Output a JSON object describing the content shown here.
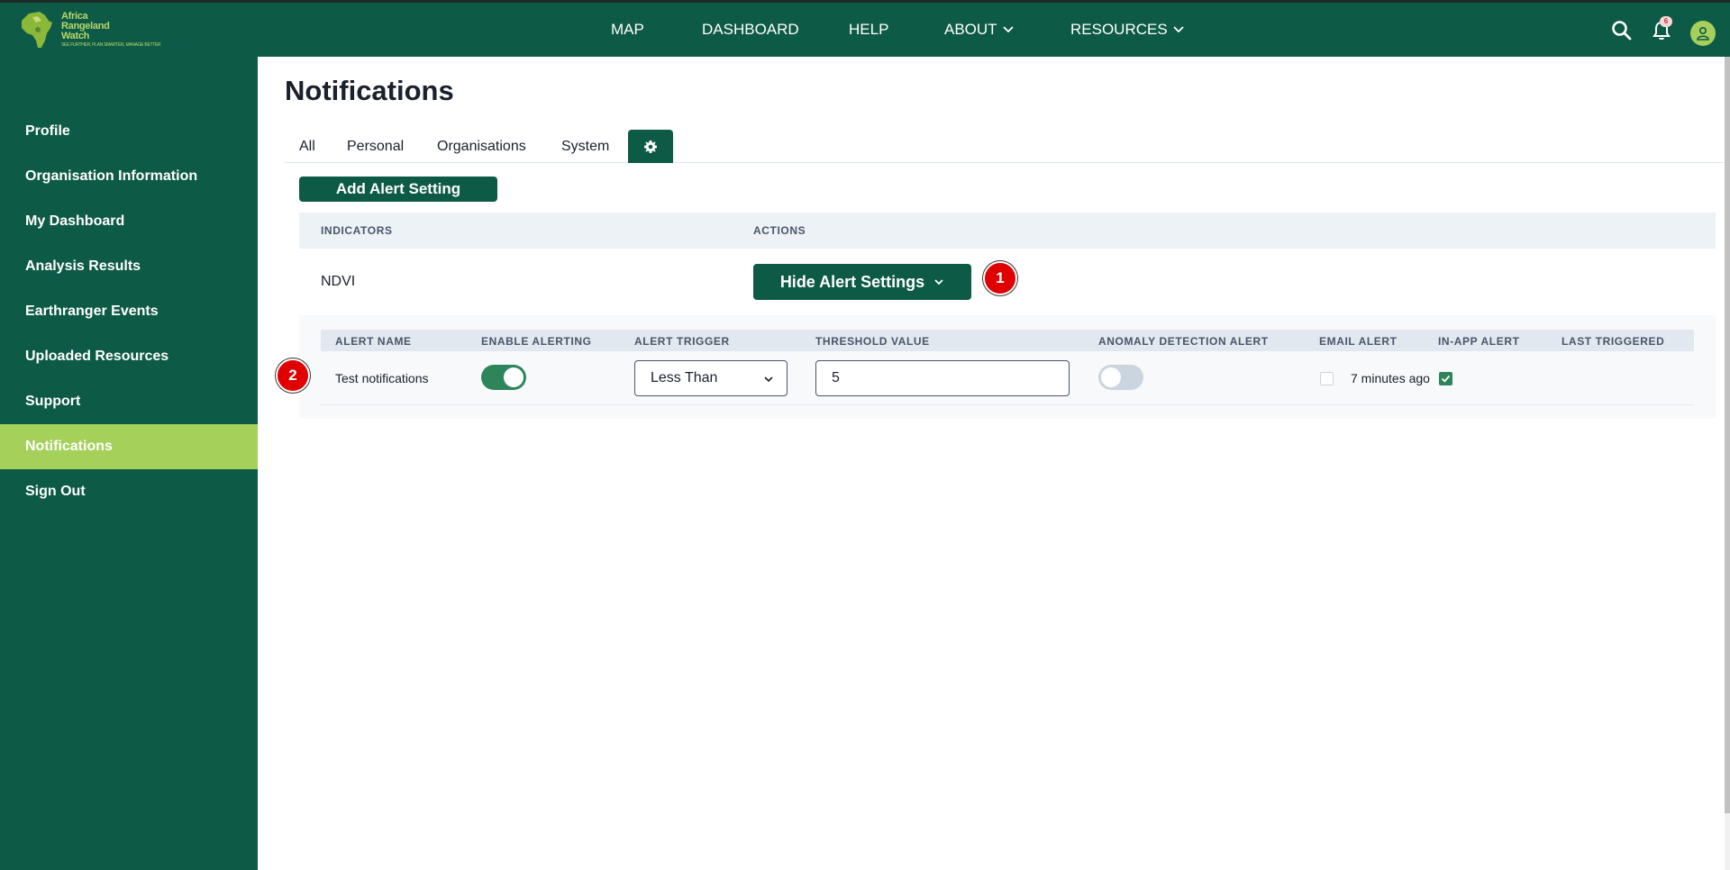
{
  "brand": {
    "name_line1": "Africa",
    "name_line2": "Rangeland",
    "name_line3": "Watch",
    "tagline": "SEE FURTHER, PLAN SMARTER, MANAGE BETTER"
  },
  "topnav": {
    "items": [
      {
        "label": "MAP"
      },
      {
        "label": "DASHBOARD"
      },
      {
        "label": "HELP"
      },
      {
        "label": "ABOUT"
      },
      {
        "label": "RESOURCES"
      }
    ],
    "notification_count": "6",
    "icons": [
      "search-icon",
      "bell-icon",
      "user-icon",
      "chevron-down-icon"
    ]
  },
  "sidebar": {
    "items": [
      {
        "label": "Profile"
      },
      {
        "label": "Organisation Information"
      },
      {
        "label": "My Dashboard"
      },
      {
        "label": "Analysis Results"
      },
      {
        "label": "Earthranger Events"
      },
      {
        "label": "Uploaded Resources"
      },
      {
        "label": "Support"
      },
      {
        "label": "Notifications"
      },
      {
        "label": "Sign Out"
      }
    ],
    "active": "Notifications"
  },
  "main": {
    "title": "Notifications",
    "tabs": [
      {
        "label": "All"
      },
      {
        "label": "Personal"
      },
      {
        "label": "Organisations"
      },
      {
        "label": "System"
      },
      {
        "label": "",
        "icon": "gear-icon"
      }
    ],
    "add_button": "Add Alert Setting",
    "table": {
      "headers": [
        "INDICATORS",
        "ACTIONS"
      ],
      "row": {
        "indicator": "NDVI",
        "action_button": "Hide Alert Settings"
      }
    },
    "alert_settings": {
      "headers": [
        "ALERT NAME",
        "ENABLE ALERTING",
        "ALERT TRIGGER",
        "THRESHOLD VALUE",
        "ANOMALY DETECTION ALERT",
        "EMAIL ALERT",
        "IN-APP ALERT",
        "LAST TRIGGERED"
      ],
      "row": {
        "name": "Test notifications",
        "enable_alerting": true,
        "trigger": "Less Than",
        "threshold": "5",
        "anomaly_detection": false,
        "email_alert": false,
        "in_app_alert": true,
        "last_triggered": "7 minutes ago"
      }
    }
  },
  "markers": [
    {
      "label": "1"
    },
    {
      "label": "2"
    }
  ],
  "colors": {
    "primary": "#0d5a46",
    "accent": "#a5d05a",
    "toggle_on": "#2f855a",
    "marker": "#e00000"
  }
}
